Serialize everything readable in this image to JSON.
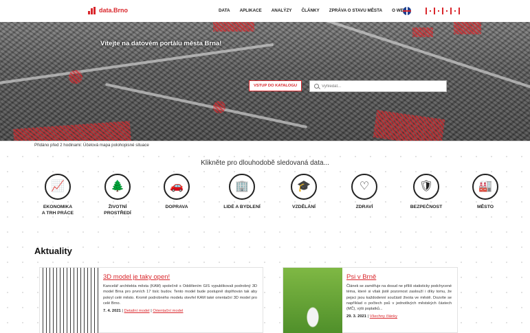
{
  "header": {
    "logo_text": "data.Brno",
    "nav": [
      "DATA",
      "APLIKACE",
      "ANALÝZY",
      "ČLÁNKY",
      "ZPRÁVA O STAVU MĚSTA",
      "O WEBU"
    ],
    "language_icon": "uk-flag-icon",
    "brand_icon": "brno-logo-icon"
  },
  "hero": {
    "title": "Vítejte na datovém portálu města Brna!",
    "catalog_button": "VSTUP DO KATALOGU",
    "search_placeholder": "Vyhledat..."
  },
  "ticker": {
    "text": "Přidáno před 2 hodinami: Účelová mapa polohopisné situace"
  },
  "categories": {
    "heading": "Klikněte pro dlouhodobě sledovaná data...",
    "items": [
      {
        "label": "EKONOMIKA\nA TRH PRÁCE",
        "icon": "📈"
      },
      {
        "label": "ŽIVOTNÍ\nPROSTŘEDÍ",
        "icon": "🌲"
      },
      {
        "label": "DOPRAVA",
        "icon": "🚗"
      },
      {
        "label": "LIDÉ A BYDLENÍ",
        "icon": "🏢"
      },
      {
        "label": "VZDĚLÁNÍ",
        "icon": "🎓"
      },
      {
        "label": "ZDRAVÍ",
        "icon": "♡"
      },
      {
        "label": "BEZPEČNOST",
        "icon": "🛡"
      },
      {
        "label": "MĚSTO",
        "icon": "🏭"
      }
    ]
  },
  "news": {
    "heading": "Aktuality",
    "articles": [
      {
        "title": "3D model je taky open!",
        "text": "Kancelář architekta města (KAM) společně s Oddělením GIS vypublikovali podrobný 3D model Brna pro prvních 17 tisíc budov. Tento model bude postupně doplňován tak aby pokryl celé město. Kromě podrobného modelu otevřel KAM také orientační 3D model pro celé Brno.",
        "date": "7. 4. 2021",
        "links": [
          "Detailní model",
          "Orientační model"
        ]
      },
      {
        "title": "Psi v Brně",
        "text": "Článek se zaměřuje na dosud ne příliš statisticky podchycené téma, které si však jistě pozornost zaslouží i díky tomu, že pejsci jsou každodenní součástí života ve městě. Dozvíte se například o počtech psů v jednotlivých městských částech (MČ), výši poplatků...",
        "date": "29. 3. 2021",
        "links": [
          "Všechny články"
        ]
      }
    ]
  },
  "colors": {
    "accent": "#d9262b"
  }
}
